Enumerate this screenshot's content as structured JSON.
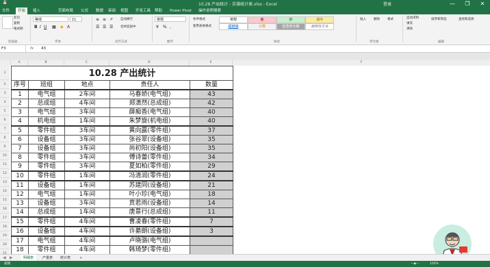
{
  "window": {
    "title": "10.28 产出统计 - 实操统计表.xlsx - Excel",
    "user": "登录",
    "minimize": "—",
    "restore": "❐",
    "close": "✕"
  },
  "tabs": [
    "文件",
    "开始",
    "插入",
    "页面布局",
    "公式",
    "数据",
    "审阅",
    "视图",
    "开发工具",
    "帮助",
    "Power Pivot",
    "操作说明搜索"
  ],
  "ribbon": {
    "cut": "剪切",
    "copy": "复制",
    "format_painter": "格式刷",
    "clipboard_group": "剪贴板",
    "font_name": "等线",
    "font_size": "11",
    "font_group": "字体",
    "wrap_text": "自动换行",
    "merge_center": "合并后居中",
    "align_group": "对齐方式",
    "number_format": "常规",
    "number_group": "数字",
    "cond_format": "条件格式",
    "table_format": "套用表格格式",
    "styles_group": "样式",
    "style_cells": [
      "常规",
      "差",
      "好",
      "适中",
      "超链接",
      "计算",
      "检查单元格",
      "解释性文本"
    ],
    "insert": "插入",
    "delete": "删除",
    "format": "格式",
    "cells_group": "单元格",
    "autosum": "自动求和",
    "fill": "填充",
    "clear": "清除",
    "sort_filter": "排序和筛选",
    "find_select": "查找和选择",
    "edit_group": "编辑"
  },
  "formula_bar": {
    "name_box": "F3",
    "fx": "fx",
    "formula": "43"
  },
  "columns": [
    "A",
    "B",
    "C",
    "D",
    "E",
    "F"
  ],
  "sheet": {
    "title": "10.28 产出统计",
    "headers": [
      "序号",
      "班组",
      "地点",
      "责任人",
      "数量"
    ],
    "rows": [
      [
        "1",
        "电气组",
        "2车间",
        "马春娇(电气组)",
        "43"
      ],
      [
        "2",
        "总成组",
        "4车间",
        "郑潇然(总成组)",
        "42"
      ],
      [
        "3",
        "电气组",
        "3车间",
        "薛痴香(电气组)",
        "40"
      ],
      [
        "4",
        "机电组",
        "1车间",
        "朱梦旋(机电组)",
        "40"
      ],
      [
        "5",
        "零件组",
        "3车间",
        "黄向露(零件组)",
        "37"
      ],
      [
        "6",
        "设备组",
        "3车间",
        "张谷翠(设备组)",
        "35"
      ],
      [
        "7",
        "设备组",
        "3车间",
        "尚初阳(设备组)",
        "35"
      ],
      [
        "8",
        "零件组",
        "3车间",
        "傅诗蕾(零件组)",
        "34"
      ],
      [
        "9",
        "零件组",
        "3车间",
        "夏如柏(零件组)",
        "29"
      ],
      [
        "10",
        "零件组",
        "1车间",
        "冯清润(零件组)",
        "24"
      ],
      [
        "11",
        "设备组",
        "1车间",
        "苏建同(设备组)",
        "21"
      ],
      [
        "12",
        "电气组",
        "1车间",
        "叶小珍(电气组)",
        "18"
      ],
      [
        "13",
        "设备组",
        "3车间",
        "贲若雨(设备组)",
        "14"
      ],
      [
        "14",
        "总成组",
        "1车间",
        "唐景行(总成组)",
        "11"
      ],
      [
        "15",
        "零件组",
        "4车间",
        "曹凌春(零件组)",
        "7"
      ],
      [
        "16",
        "设备组",
        "4车间",
        "许綦朗(设备组)",
        "3"
      ],
      [
        "17",
        "电气组",
        "4车间",
        "卢晓骆(电气组)",
        ""
      ],
      [
        "18",
        "零件组",
        "4车间",
        "韩琦梦(零件组)",
        ""
      ]
    ],
    "row_numbers": [
      "1",
      "2",
      "3",
      "4",
      "5",
      "6",
      "7",
      "8",
      "9",
      "10",
      "11",
      "12",
      "13",
      "14",
      "15",
      "16",
      "17",
      "18",
      "19",
      "20",
      "21"
    ]
  },
  "sheet_tabs": [
    "明细表",
    "产量表",
    "统计表",
    "+"
  ],
  "status": {
    "ready": "就绪",
    "zoom": "100%"
  }
}
